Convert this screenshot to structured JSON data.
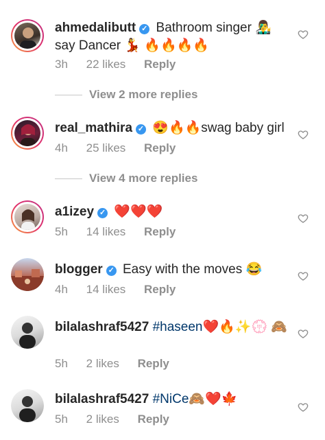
{
  "comments": [
    {
      "username": "ahmedalibutt",
      "verified": true,
      "text": "Bathroom singer 👨‍🎤 say Dancer 💃 🔥🔥🔥🔥",
      "time": "3h",
      "likes": "22 likes",
      "reply": "Reply",
      "view_more": "View 2 more replies"
    },
    {
      "username": "real_mathira",
      "verified": true,
      "text": "😍🔥🔥swag baby girl",
      "time": "4h",
      "likes": "25 likes",
      "reply": "Reply",
      "view_more": "View 4 more replies"
    },
    {
      "username": "a1izey",
      "verified": true,
      "text": "❤️❤️❤️",
      "time": "5h",
      "likes": "14 likes",
      "reply": "Reply"
    },
    {
      "username": "blogger",
      "verified": true,
      "text": "Easy with the moves 😂",
      "time": "4h",
      "likes": "14 likes",
      "reply": "Reply"
    },
    {
      "username": "bilalashraf5427",
      "verified": false,
      "hashtag": "#haseen",
      "text": "❤️🔥✨💮 🙈",
      "time": "5h",
      "likes": "2 likes",
      "reply": "Reply"
    },
    {
      "username": "bilalashraf5427",
      "verified": false,
      "hashtag": "#NiCe",
      "text": "🙈❤️🍁",
      "time": "5h",
      "likes": "2 likes",
      "reply": "Reply"
    }
  ],
  "icons": {
    "like": "heart-outline-icon",
    "verified": "verified-badge-icon"
  },
  "colors": {
    "verified": "#3897f0",
    "hashtag": "#00376b",
    "meta": "#8e8e8e"
  }
}
